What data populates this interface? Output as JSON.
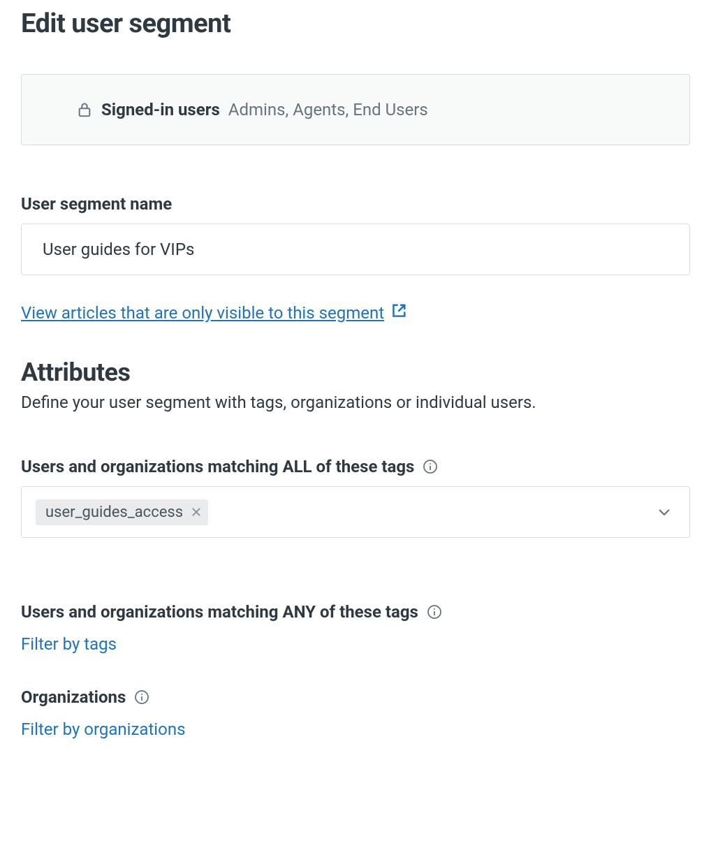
{
  "page": {
    "title": "Edit user segment"
  },
  "info_banner": {
    "title": "Signed-in users",
    "subtitle": "Admins, Agents, End Users"
  },
  "segment_name": {
    "label": "User segment name",
    "value": "User guides for VIPs"
  },
  "view_articles": {
    "label": "View articles that are only visible to this segment"
  },
  "attributes": {
    "title": "Attributes",
    "description": "Define your user segment with tags, organizations or individual users."
  },
  "tags_all": {
    "label": "Users and organizations matching ALL of these tags",
    "tags": [
      "user_guides_access"
    ]
  },
  "tags_any": {
    "label": "Users and organizations matching ANY of these tags",
    "action_label": "Filter by tags"
  },
  "organizations": {
    "label": "Organizations",
    "action_label": "Filter by organizations"
  }
}
